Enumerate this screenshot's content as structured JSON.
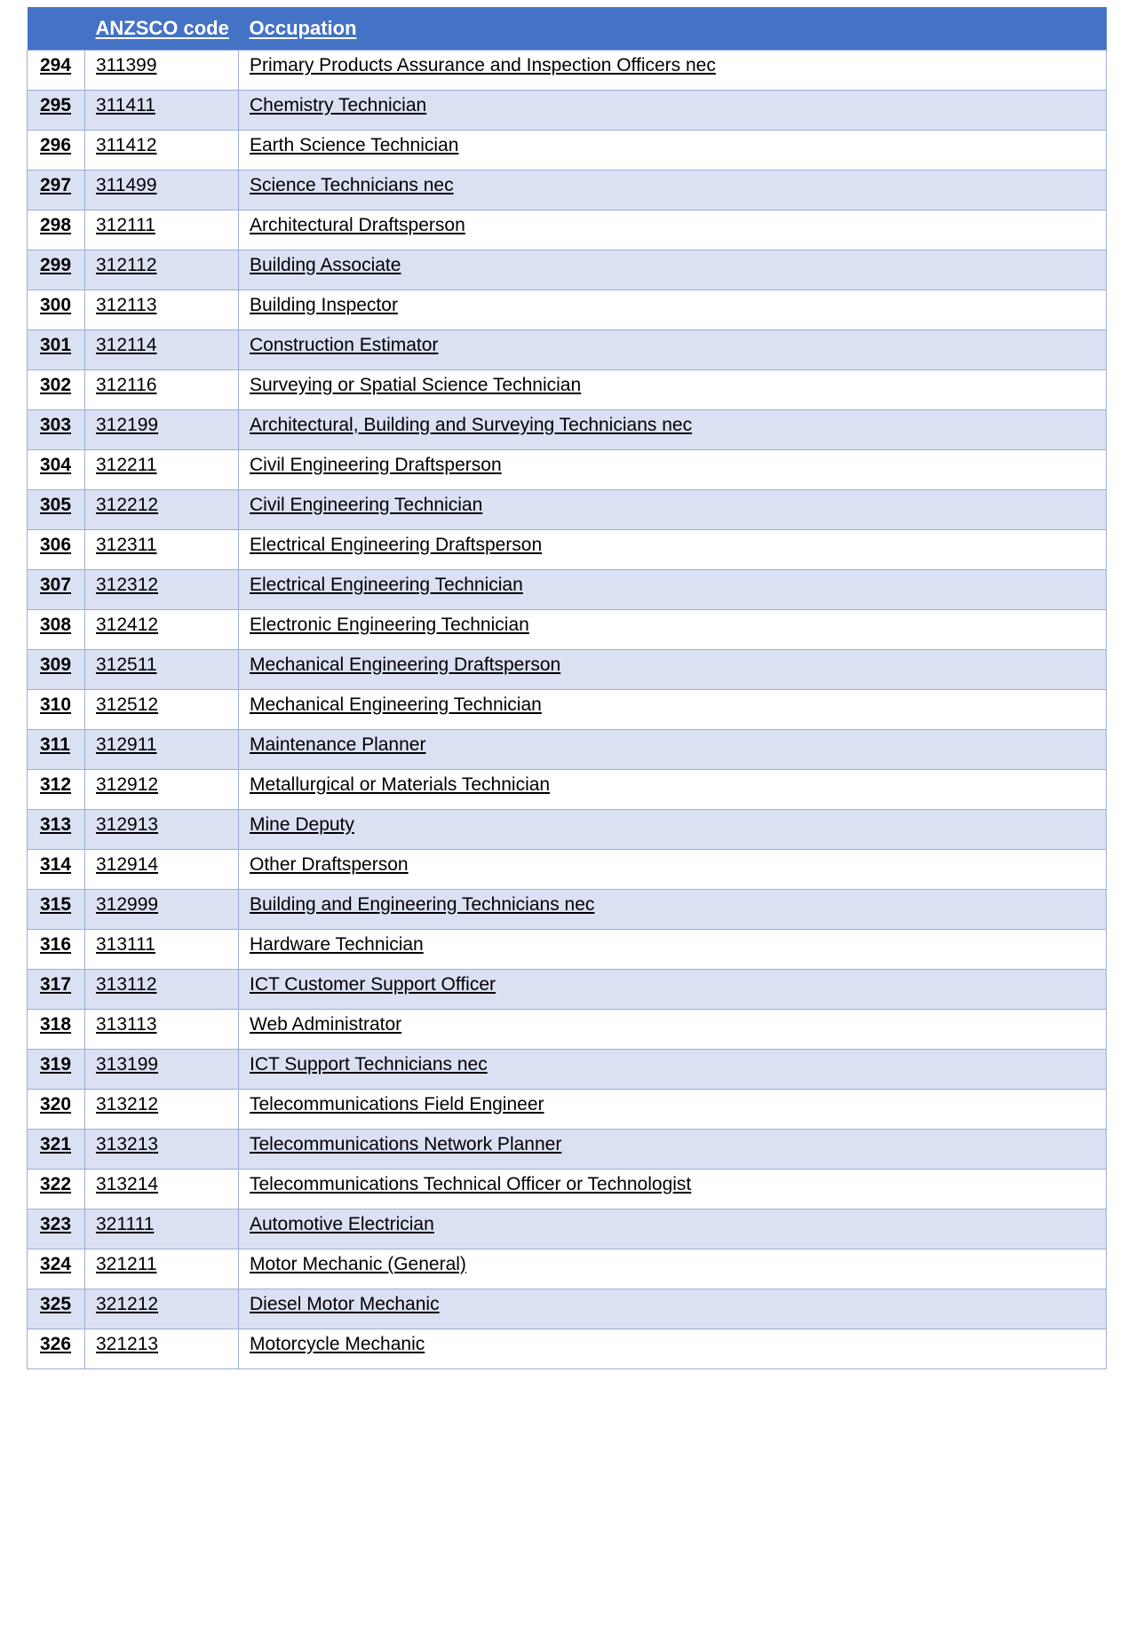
{
  "table": {
    "colors": {
      "header_background": "#4472C4",
      "header_text": "#FFFFFF",
      "alt_row_background": "#DAE1F3",
      "plain_row_background": "#FFFFFF",
      "border": "#9BAEDB",
      "body_text": "#000000"
    },
    "columns": [
      {
        "key": "index",
        "label": ""
      },
      {
        "key": "code",
        "label": "ANZSCO code"
      },
      {
        "key": "occupation",
        "label": "Occupation"
      }
    ],
    "rows": [
      {
        "index": "294",
        "code": "311399",
        "occupation": "Primary Products Assurance and Inspection Officers nec"
      },
      {
        "index": "295",
        "code": "311411",
        "occupation": "Chemistry Technician"
      },
      {
        "index": "296",
        "code": "311412",
        "occupation": "Earth Science Technician"
      },
      {
        "index": "297",
        "code": "311499",
        "occupation": "Science Technicians nec"
      },
      {
        "index": "298",
        "code": "312111",
        "occupation": "Architectural Draftsperson"
      },
      {
        "index": "299",
        "code": "312112",
        "occupation": "Building Associate"
      },
      {
        "index": "300",
        "code": "312113",
        "occupation": "Building Inspector"
      },
      {
        "index": "301",
        "code": "312114",
        "occupation": "Construction Estimator"
      },
      {
        "index": "302",
        "code": "312116",
        "occupation": "Surveying or Spatial Science Technician"
      },
      {
        "index": "303",
        "code": "312199",
        "occupation": "Architectural, Building and Surveying Technicians nec"
      },
      {
        "index": "304",
        "code": "312211",
        "occupation": "Civil Engineering Draftsperson"
      },
      {
        "index": "305",
        "code": "312212",
        "occupation": "Civil Engineering Technician"
      },
      {
        "index": "306",
        "code": "312311",
        "occupation": "Electrical Engineering Draftsperson"
      },
      {
        "index": "307",
        "code": "312312",
        "occupation": "Electrical Engineering Technician"
      },
      {
        "index": "308",
        "code": "312412",
        "occupation": "Electronic Engineering Technician"
      },
      {
        "index": "309",
        "code": "312511",
        "occupation": "Mechanical Engineering Draftsperson"
      },
      {
        "index": "310",
        "code": "312512",
        "occupation": "Mechanical Engineering Technician"
      },
      {
        "index": "311",
        "code": "312911",
        "occupation": "Maintenance Planner"
      },
      {
        "index": "312",
        "code": "312912",
        "occupation": "Metallurgical or Materials Technician"
      },
      {
        "index": "313",
        "code": "312913",
        "occupation": "Mine Deputy"
      },
      {
        "index": "314",
        "code": "312914",
        "occupation": "Other Draftsperson"
      },
      {
        "index": "315",
        "code": "312999",
        "occupation": "Building and Engineering Technicians nec"
      },
      {
        "index": "316",
        "code": "313111",
        "occupation": "Hardware Technician"
      },
      {
        "index": "317",
        "code": "313112",
        "occupation": "ICT Customer Support Officer"
      },
      {
        "index": "318",
        "code": "313113",
        "occupation": "Web Administrator"
      },
      {
        "index": "319",
        "code": "313199",
        "occupation": "ICT Support Technicians nec"
      },
      {
        "index": "320",
        "code": "313212",
        "occupation": "Telecommunications Field Engineer"
      },
      {
        "index": "321",
        "code": "313213",
        "occupation": "Telecommunications Network Planner"
      },
      {
        "index": "322",
        "code": "313214",
        "occupation": "Telecommunications Technical Officer or Technologist"
      },
      {
        "index": "323",
        "code": "321111",
        "occupation": "Automotive Electrician"
      },
      {
        "index": "324",
        "code": "321211",
        "occupation": "Motor Mechanic (General)"
      },
      {
        "index": "325",
        "code": "321212",
        "occupation": "Diesel Motor Mechanic"
      },
      {
        "index": "326",
        "code": "321213",
        "occupation": "Motorcycle Mechanic"
      }
    ]
  }
}
